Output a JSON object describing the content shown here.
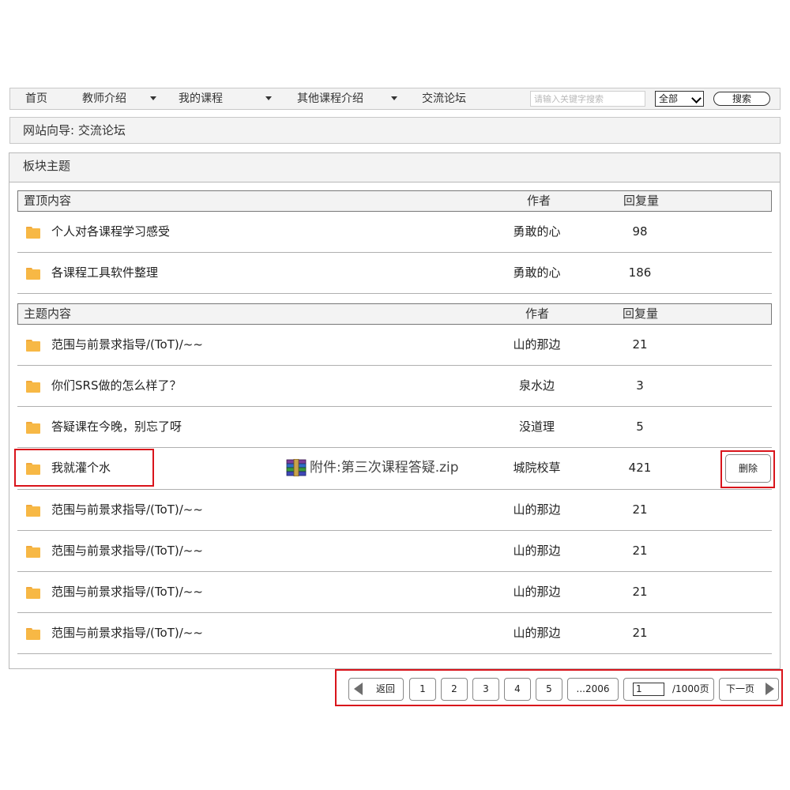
{
  "nav": {
    "items": [
      "首页",
      "教师介绍",
      "我的课程",
      "其他课程介绍",
      "交流论坛"
    ],
    "search_placeholder": "请输入关键字搜索",
    "scope_selected": "全部",
    "search_button": "搜索"
  },
  "breadcrumb": "网站向导: 交流论坛",
  "panel_title": "板块主题",
  "pinned": {
    "header": {
      "title": "置顶内容",
      "author": "作者",
      "replies": "回复量"
    },
    "rows": [
      {
        "title": "个人对各课程学习感受",
        "author": "勇敢的心",
        "replies": "98"
      },
      {
        "title": "各课程工具软件整理",
        "author": "勇敢的心",
        "replies": "186"
      }
    ]
  },
  "topics": {
    "header": {
      "title": "主题内容",
      "author": "作者",
      "replies": "回复量"
    },
    "rows": [
      {
        "title": "范围与前景求指导/(ToT)/~~",
        "author": "山的那边",
        "replies": "21"
      },
      {
        "title": "你们SRS做的怎么样了？",
        "author": "泉水边",
        "replies": "3"
      },
      {
        "title": "答疑课在今晚，别忘了呀",
        "author": "没道理",
        "replies": "5"
      },
      {
        "title": "我就灌个水",
        "author": "城院校草",
        "replies": "421",
        "attachment": "附件:第三次课程答疑.zip",
        "delete_label": "删除"
      },
      {
        "title": "范围与前景求指导/(ToT)/~~",
        "author": "山的那边",
        "replies": "21"
      },
      {
        "title": "范围与前景求指导/(ToT)/~~",
        "author": "山的那边",
        "replies": "21"
      },
      {
        "title": "范围与前景求指导/(ToT)/~~",
        "author": "山的那边",
        "replies": "21"
      },
      {
        "title": "范围与前景求指导/(ToT)/~~",
        "author": "山的那边",
        "replies": "21"
      }
    ]
  },
  "pagination": {
    "back": "返回",
    "pages": [
      "1",
      "2",
      "3",
      "4",
      "5",
      "...2006"
    ],
    "current_page": "1",
    "total": "/1000页",
    "next": "下一页"
  },
  "colors": {
    "highlight": "#d9141b",
    "folder": "#f7b845",
    "bar_bg": "#f3f3f3"
  }
}
